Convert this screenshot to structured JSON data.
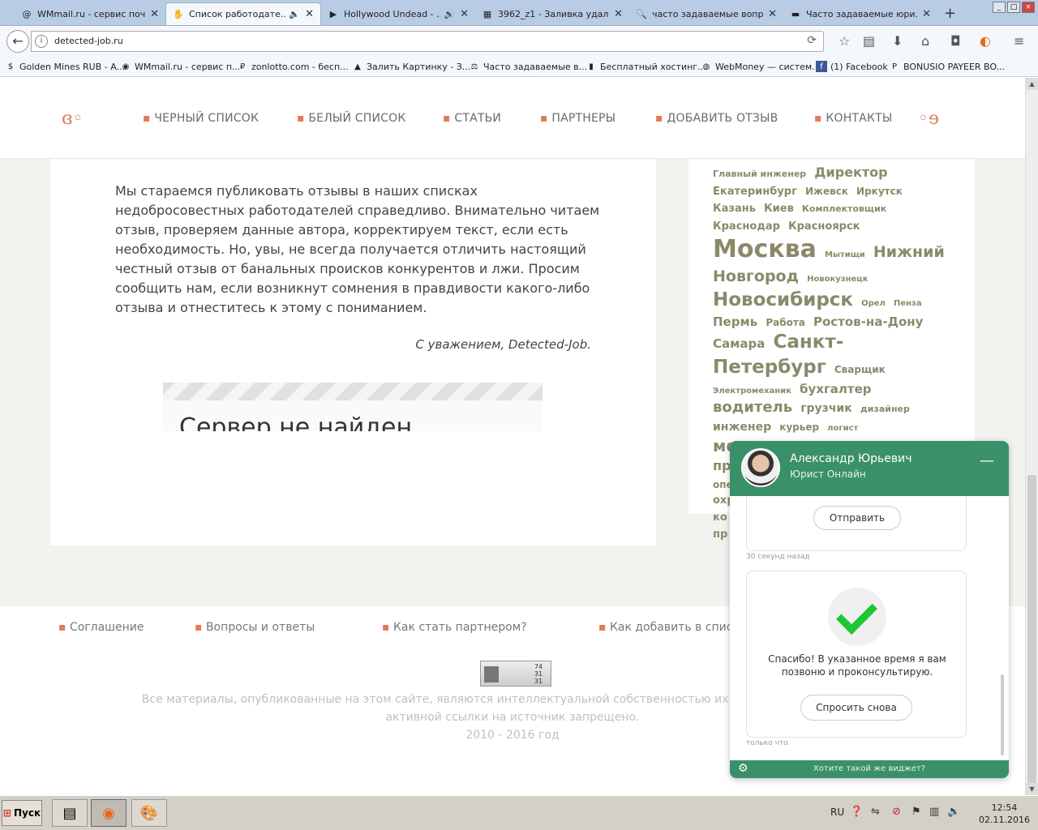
{
  "browser": {
    "tabs": [
      {
        "title": "WMmail.ru - сервис почт...",
        "icon": "@"
      },
      {
        "title": "Список работодате...",
        "icon": "✋",
        "active": true,
        "sound": "🔈"
      },
      {
        "title": "Hollywood Undead - ...",
        "icon": "▶",
        "sound": "🔊"
      },
      {
        "title": "3962_z1 - Заливка удал...",
        "icon": "▦"
      },
      {
        "title": "часто задаваемые вопр...",
        "icon": "🔍"
      },
      {
        "title": "Часто задаваемые юри...",
        "icon": "▬"
      }
    ],
    "close_glyph": "✕",
    "newtab_glyph": "+",
    "url": "detected-job.ru",
    "bookmarks": [
      {
        "label": "Golden Mines RUB - A...",
        "icon": "$"
      },
      {
        "label": "WMmail.ru - сервис п...",
        "icon": "◉"
      },
      {
        "label": "zonlotto.com - бесп...",
        "icon": "₽"
      },
      {
        "label": "Залить Картинку - З...",
        "icon": "▲"
      },
      {
        "label": "Часто задаваемые в...",
        "icon": "⚖"
      },
      {
        "label": "Бесплатный хостинг...",
        "icon": "▮"
      },
      {
        "label": "WebMoney — систем...",
        "icon": "◍"
      },
      {
        "label": "(1) Facebook",
        "icon": "f"
      },
      {
        "label": "BONUSIO PAYEER BO...",
        "icon": "P"
      }
    ]
  },
  "site": {
    "nav": [
      "ЧЕРНЫЙ СПИСОК",
      "БЕЛЫЙ СПИСОК",
      "СТАТЬИ",
      "ПАРТНЕРЫ",
      "ДОБАВИТЬ ОТЗЫВ",
      "КОНТАКТЫ"
    ],
    "paragraph": "Мы стараемся публиковать отзывы в наших списках недобросовестных работодателей справедливо. Внимательно читаем отзыв, проверяем данные автора, корректируем текст, если есть необходимость. Но, увы, не всегда получается отличить настоящий честный отзыв от банальных происков конкурентов и лжи. Просим сообщить нам, если возникнут сомнения в правдивости какого-либо отзыва и отнеститесь к этому с пониманием.",
    "signature": "С уважением, Detected-Job.",
    "error_title": "Сервер не найден",
    "tags": [
      {
        "t": "Главный инженер",
        "s": 11
      },
      {
        "t": "Директор",
        "s": 16
      },
      {
        "t": "Екатеринбург",
        "s": 13
      },
      {
        "t": "Ижевск",
        "s": 12
      },
      {
        "t": "Иркутск",
        "s": 12
      },
      {
        "t": "Казань",
        "s": 13
      },
      {
        "t": "Киев",
        "s": 13
      },
      {
        "t": "Комплектовщик",
        "s": 11
      },
      {
        "t": "Краснодар",
        "s": 13
      },
      {
        "t": "Красноярск",
        "s": 13
      },
      {
        "t": "Москва",
        "s": 30
      },
      {
        "t": "Мытищи",
        "s": 10
      },
      {
        "t": "Нижний Новгород",
        "s": 19
      },
      {
        "t": "Новокузнецк",
        "s": 10
      },
      {
        "t": "Новосибирск",
        "s": 23
      },
      {
        "t": "Орел",
        "s": 10
      },
      {
        "t": "Пенза",
        "s": 10
      },
      {
        "t": "Пермь",
        "s": 15
      },
      {
        "t": "Работа",
        "s": 12
      },
      {
        "t": "Ростов-на-Дону",
        "s": 15
      },
      {
        "t": "Самара",
        "s": 15
      },
      {
        "t": "Санкт-Петербург",
        "s": 23
      },
      {
        "t": "Сварщик",
        "s": 12
      },
      {
        "t": "Электромеханик",
        "s": 10
      },
      {
        "t": "бухгалтер",
        "s": 15
      },
      {
        "t": "водитель",
        "s": 18
      },
      {
        "t": "грузчик",
        "s": 14
      },
      {
        "t": "дизайнер",
        "s": 11
      },
      {
        "t": "инженер",
        "s": 14
      },
      {
        "t": "курьер",
        "s": 12
      },
      {
        "t": "логист",
        "s": 10
      },
      {
        "t": "менеджер",
        "s": 20
      },
      {
        "t": "менеджер по продажам",
        "s": 16
      },
      {
        "t": "менеджер продаж",
        "s": 11
      },
      {
        "t": "оператор",
        "s": 12
      }
    ],
    "tags_cut": [
      "охр",
      "ко",
      "пр"
    ],
    "footer_links": [
      "Соглашение",
      "Вопросы и ответы",
      "Как стать партнером?",
      "Как добавить в список"
    ],
    "counter": {
      "a": "74",
      "b": "31",
      "c": "31"
    },
    "copyright_line1": "Все материалы, опубликованные на этом сайте, являются интеллектуальной собственностью их авторов и редакторов пр",
    "copyright_line2": "активной ссылки на источник запрещено.",
    "copyright_line3": "2010 - 2016 год"
  },
  "chat": {
    "agent_name": "Александр Юрьевич",
    "agent_role": "Юрист Онлайн",
    "minimize": "—",
    "send_label": "Отправить",
    "time1": "30 секунд назад",
    "thanks": "Спасибо! В указанное время я вам позвоню и проконсультирую.",
    "ask_again": "Спросить снова",
    "time2": "только что",
    "widget_link": "Хотите такой же виджет?",
    "accent": "#3a9069"
  },
  "taskbar": {
    "start": "Пуск",
    "lang": "RU",
    "time": "12:54",
    "date": "02.11.2016"
  }
}
